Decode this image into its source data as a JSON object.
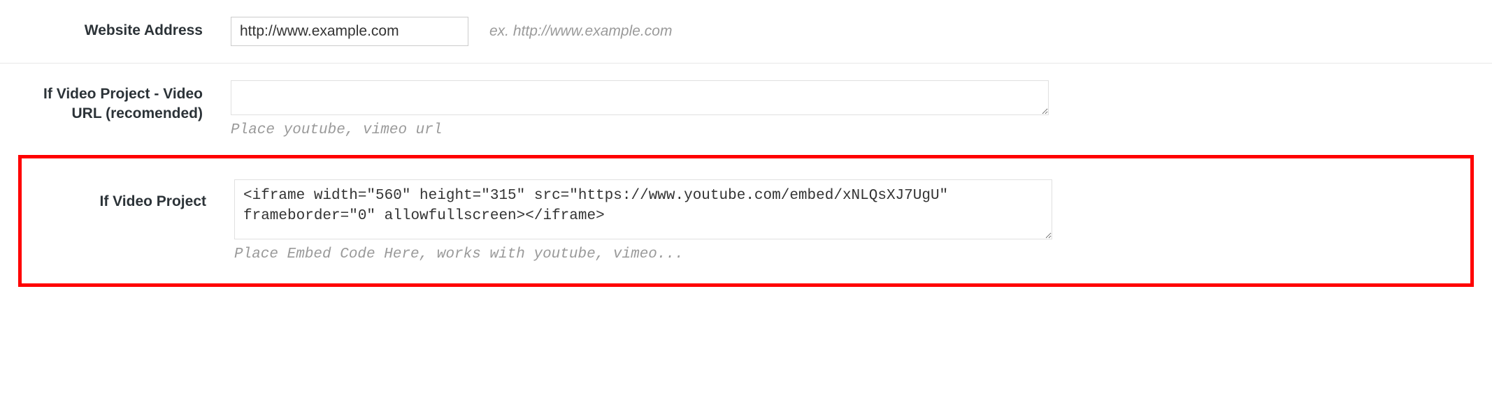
{
  "fields": {
    "website": {
      "label": "Website Address",
      "value": "http://www.example.com",
      "hint": "ex. http://www.example.com"
    },
    "video_url": {
      "label": "If Video Project - Video URL (recomended)",
      "value": "",
      "hint": "Place youtube, vimeo url"
    },
    "video_embed": {
      "label": "If Video Project",
      "value": "<iframe width=\"560\" height=\"315\" src=\"https://www.youtube.com/embed/xNLQsXJ7UgU\" frameborder=\"0\" allowfullscreen></iframe>",
      "hint": "Place Embed Code Here, works with youtube, vimeo..."
    }
  }
}
